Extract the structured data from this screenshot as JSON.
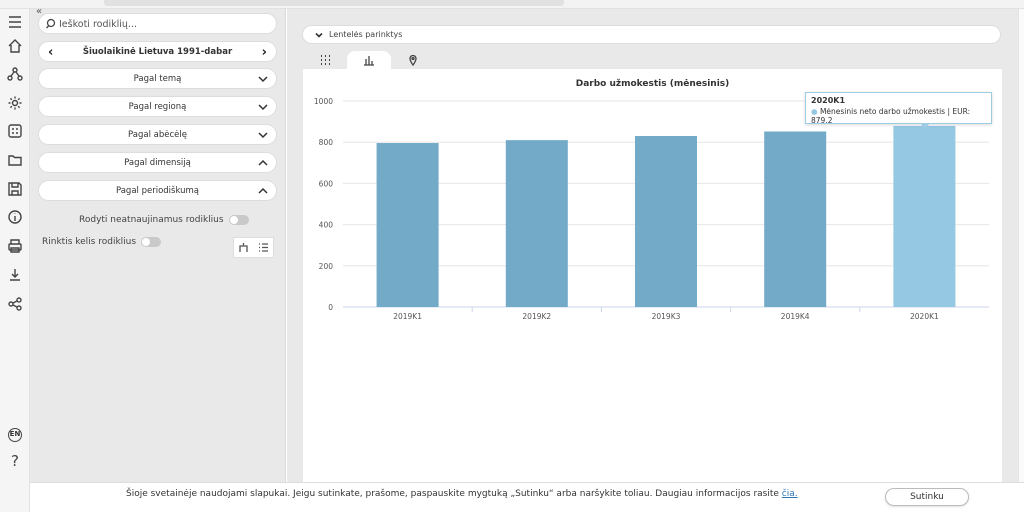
{
  "sidebar": {
    "collapse_glyph": "«",
    "search": {
      "placeholder": "Ieškoti rodiklių..."
    },
    "period_selector": {
      "label": "Šiuolaikinė Lietuva 1991-dabar"
    },
    "filters": [
      {
        "label": "Pagal temą",
        "state": "collapsed"
      },
      {
        "label": "Pagal regioną",
        "state": "collapsed"
      },
      {
        "label": "Pagal abėcėlę",
        "state": "collapsed"
      },
      {
        "label": "Pagal dimensiją",
        "state": "expanded"
      },
      {
        "label": "Pagal periodiškumą",
        "state": "expanded"
      }
    ],
    "toggles": {
      "show_outdated": "Rodyti neatnaujinamus rodiklius",
      "select_multiple": "Rinktis kelis rodiklius"
    }
  },
  "rail": {
    "icons": [
      "menu-icon",
      "home-icon",
      "network-icon",
      "gear-icon",
      "calculator-icon",
      "folder-icon",
      "save-icon",
      "info-icon",
      "printer-icon",
      "download-icon",
      "share-icon"
    ],
    "language": "EN",
    "help": "?"
  },
  "main": {
    "options_bar": "Lentelės parinktys",
    "tabs": [
      "table-tab",
      "chart-tab",
      "map-tab"
    ],
    "active_tab": "chart-tab"
  },
  "chart_data": {
    "type": "bar",
    "title": "Darbo užmokestis (mėnesinis)",
    "categories": [
      "2019K1",
      "2019K2",
      "2019K3",
      "2019K4",
      "2020K1"
    ],
    "series": [
      {
        "name": "Mėnesinis neto darbo užmokestis",
        "values": [
          796,
          810,
          830,
          852,
          879.2
        ]
      }
    ],
    "ylim": [
      0,
      1000
    ],
    "yticks": [
      0,
      200,
      400,
      600,
      800,
      1000
    ],
    "grid": true,
    "colors": {
      "bar": "#72aac8",
      "highlight": "#95c9e3"
    },
    "highlight_index": 4,
    "tooltip": {
      "title": "2020K1",
      "marker": "●",
      "text": "Mėnesinis neto darbo užmokestis | EUR: 879.2"
    }
  },
  "cookie": {
    "text": "Šioje svetainėje naudojami slapukai. Jeigu sutinkate, prašome, paspauskite mygtuką „Sutinku“ arba naršykite toliau. Daugiau informacijos rasite ",
    "link": "čia.",
    "button": "Sutinku"
  }
}
